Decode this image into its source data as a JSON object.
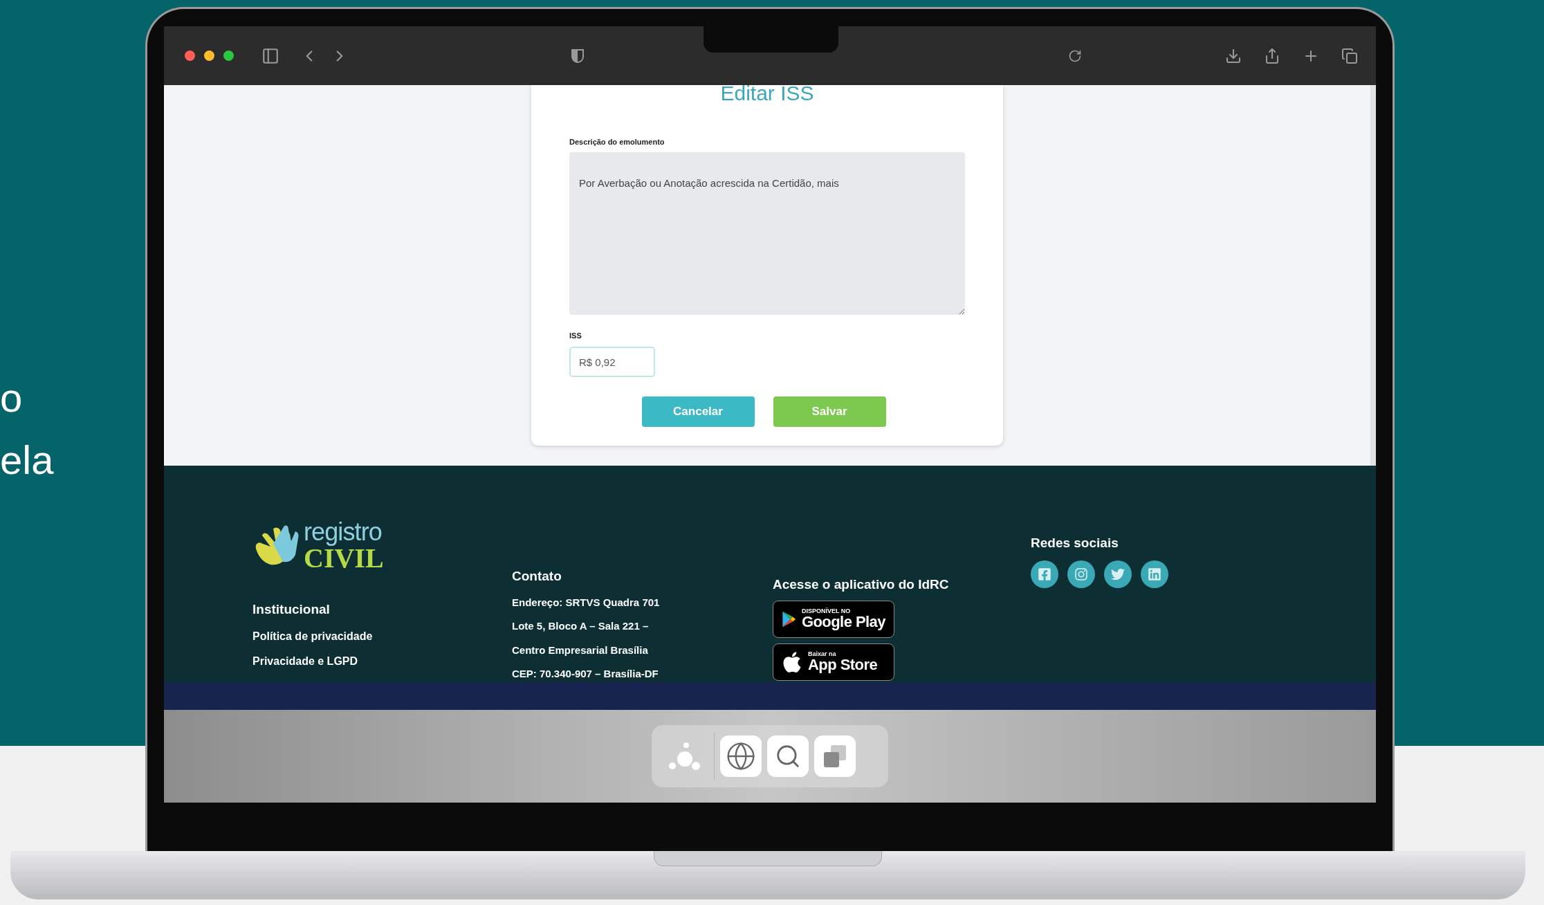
{
  "backdrop_text": [
    "o",
    "ela"
  ],
  "form": {
    "title": "Editar ISS",
    "description_label": "Descrição do emolumento",
    "description_value": "Por Averbação ou Anotação acrescida na Certidão, mais",
    "iss_label": "ISS",
    "iss_value": "R$ 0,92",
    "buttons": [
      {
        "label": "Cancelar",
        "kind": "cancel"
      },
      {
        "label": "Salvar",
        "kind": "save"
      }
    ]
  },
  "footer": {
    "logo": {
      "top": "registro",
      "bottom": "CIVIL"
    },
    "institutional": {
      "heading": "Institucional",
      "links": [
        "Política de privacidade",
        "Privacidade e LGPD"
      ]
    },
    "contact": {
      "heading": "Contato",
      "lines": [
        "Endereço: SRTVS Quadra 701",
        "Lote 5, Bloco A – Sala 221 –",
        "Centro Empresarial Brasília",
        "CEP: 70.340-907 – Brasília-DF"
      ]
    },
    "app": {
      "heading": "Acesse o aplicativo do IdRC",
      "badges": [
        {
          "kind": "google",
          "caption": "DISPONÍVEL NO",
          "store": "Google Play"
        },
        {
          "kind": "apple",
          "caption": "Baixar na",
          "store": "App Store"
        }
      ]
    },
    "social": {
      "heading": "Redes sociais"
    }
  }
}
